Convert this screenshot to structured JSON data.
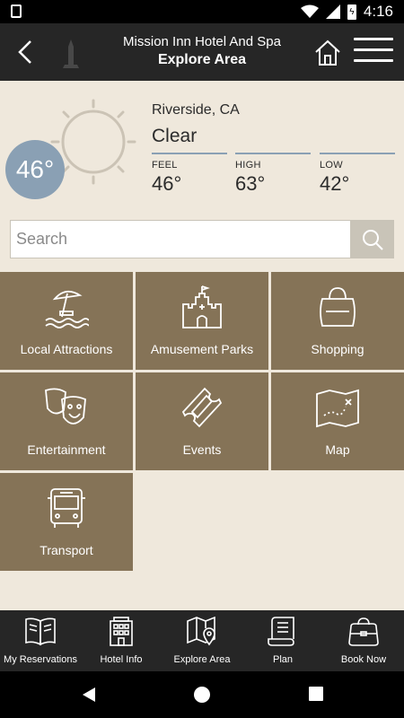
{
  "status_bar": {
    "time": "4:16",
    "battery_glyph": "ϟ"
  },
  "header": {
    "title": "Mission Inn Hotel And Spa",
    "subtitle": "Explore Area"
  },
  "weather": {
    "location": "Riverside, CA",
    "condition": "Clear",
    "current_temp": "46°",
    "stats": [
      {
        "label": "FEEL",
        "value": "46°"
      },
      {
        "label": "HIGH",
        "value": "63°"
      },
      {
        "label": "LOW",
        "value": "42°"
      }
    ],
    "accent_color": "#8aa0b4"
  },
  "search": {
    "placeholder": "Search"
  },
  "categories": [
    {
      "label": "Local Attractions",
      "icon": "beach-umbrella-icon"
    },
    {
      "label": "Amusement Parks",
      "icon": "castle-icon"
    },
    {
      "label": "Shopping",
      "icon": "shopping-bag-icon"
    },
    {
      "label": "Entertainment",
      "icon": "theater-mask-icon"
    },
    {
      "label": "Events",
      "icon": "ticket-icon"
    },
    {
      "label": "Map",
      "icon": "treasure-map-icon"
    },
    {
      "label": "Transport",
      "icon": "bus-icon"
    }
  ],
  "bottom_nav": [
    {
      "label": "My Reservations",
      "icon": "book-icon"
    },
    {
      "label": "Hotel Info",
      "icon": "building-icon"
    },
    {
      "label": "Explore Area",
      "icon": "map-pin-icon"
    },
    {
      "label": "Plan",
      "icon": "scroll-icon"
    },
    {
      "label": "Book Now",
      "icon": "suitcase-icon"
    }
  ],
  "colors": {
    "background": "#efe8dc",
    "tile": "#857357",
    "header": "#262626"
  }
}
